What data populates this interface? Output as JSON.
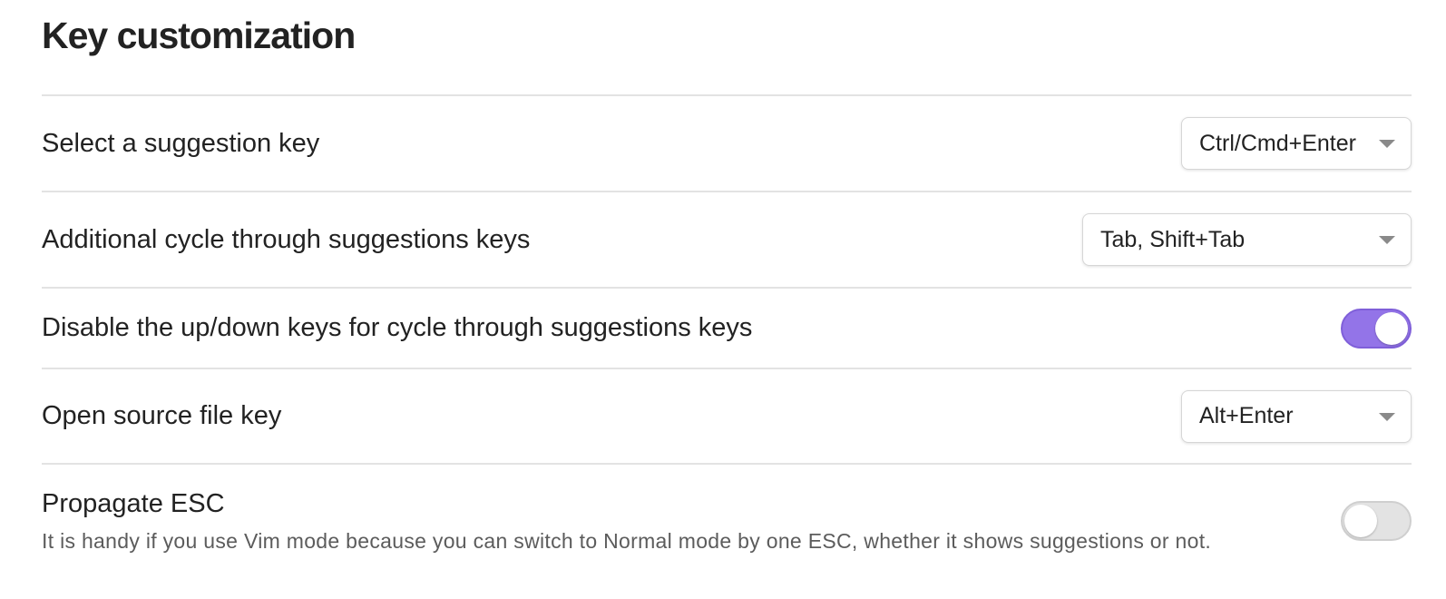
{
  "section": {
    "title": "Key customization"
  },
  "settings": [
    {
      "name": "Select a suggestion key",
      "control": "dropdown",
      "value": "Ctrl/Cmd+Enter"
    },
    {
      "name": "Additional cycle through suggestions keys",
      "control": "dropdown",
      "value": "Tab, Shift+Tab"
    },
    {
      "name": "Disable the up/down keys for cycle through suggestions keys",
      "control": "toggle",
      "checked": true
    },
    {
      "name": "Open source file key",
      "control": "dropdown",
      "value": "Alt+Enter"
    },
    {
      "name": "Propagate ESC",
      "description": "It is handy if you use Vim mode because you can switch to Normal mode by one ESC, whether it shows suggestions or not.",
      "control": "toggle",
      "checked": false
    }
  ],
  "colors": {
    "toggle_on": "#9374e8",
    "toggle_off": "#e3e3e3",
    "divider": "#e3e3e3",
    "text": "#222222",
    "description": "#5c5c5c"
  },
  "icons": {
    "dropdown_caret": "chevron-down-icon"
  }
}
